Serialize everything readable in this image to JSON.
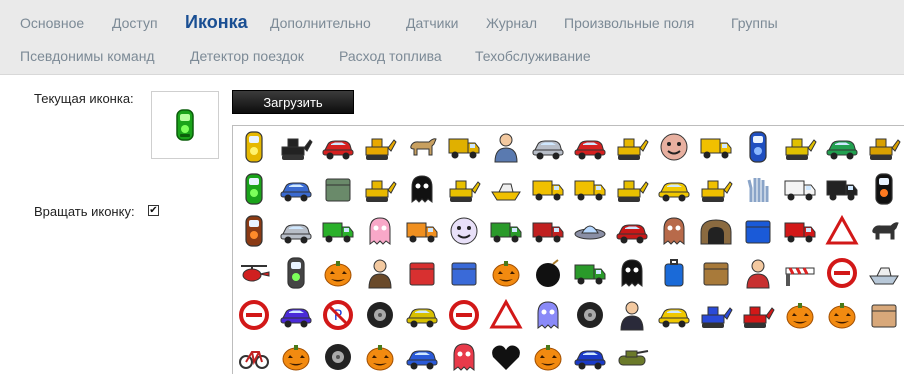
{
  "tabs": [
    {
      "label": "Основное",
      "active": false
    },
    {
      "label": "Доступ",
      "active": false
    },
    {
      "label": "Иконка",
      "active": true
    },
    {
      "label": "Дополнительно",
      "active": false
    },
    {
      "label": "Датчики",
      "active": false
    },
    {
      "label": "Журнал",
      "active": false
    },
    {
      "label": "Произвольные поля",
      "active": false
    },
    {
      "label": "Группы",
      "active": false
    },
    {
      "label": "Псевдонимы команд",
      "active": false
    },
    {
      "label": "Детектор поездок",
      "active": false
    },
    {
      "label": "Расход топлива",
      "active": false
    },
    {
      "label": "Техобслуживание",
      "active": false
    }
  ],
  "current_icon_label": "Текущая иконка:",
  "upload_label": "Загрузить",
  "rotate_label": "Вращать иконку:",
  "rotate_checked": true,
  "rotate_check_glyph": "✔",
  "current_icon": "traffic-light-car-green",
  "icons": [
    "traffic-light-car-yellow",
    "tractor",
    "red-sports-car",
    "excavator",
    "camel",
    "dump-truck",
    "worker",
    "silver-car",
    "red-sports-car",
    "bulldozer",
    "face-character",
    "yellow-dump-truck",
    "traffic-light-car-blue",
    "yellow-tractor",
    "cars-pair",
    "backhoe",
    "traffic-light-car-green",
    "blue-jeep",
    "green-robot",
    "bulldozer",
    "black-monster",
    "yellow-loader",
    "inflatable-boat",
    "yellow-truck",
    "yellow-dump-truck",
    "yellow-loader",
    "yellow-sports-car",
    "forklift",
    "robot-hand",
    "ambulance",
    "black-truck",
    "black-traffic-car",
    "traffic-light-car-red",
    "silver-car",
    "green-bus",
    "pink-ghost",
    "orange-truck",
    "cartoon-face",
    "green-truck",
    "red-bus",
    "ufo",
    "race-car",
    "brown-monster",
    "tunnel",
    "blue-box",
    "red-fire-truck",
    "yield-sign",
    "horse",
    "helicopter",
    "traffic-light",
    "pumpkin",
    "man-with-car",
    "red-bag",
    "stroller",
    "pumpkin",
    "black-bomb",
    "green-truck",
    "black-monster",
    "blue-suitcase",
    "brown-boxes",
    "worker-red",
    "barrier",
    "no-entry-sign",
    "yacht",
    "no-entry-sign",
    "blue-limousine",
    "no-parking-sign",
    "tire",
    "yellow-hummer",
    "no-entry-sign",
    "warning-sign",
    "blue-ghost",
    "silver-wheels",
    "police-officer",
    "yellow-sports-car",
    "atv",
    "red-atv",
    "pumpkin",
    "pumpkin",
    "totem",
    "bicycle",
    "pumpkin",
    "tire",
    "pumpkin",
    "blue-car",
    "red-octopus",
    "black-heart",
    "pumpkin",
    "blue-sports-car",
    "tank"
  ],
  "colors": {
    "tab_inactive": "#7c8a96",
    "tab_active": "#1a4f93",
    "tabbar_bg": "#eaeaea",
    "button_bg": "#111111"
  }
}
